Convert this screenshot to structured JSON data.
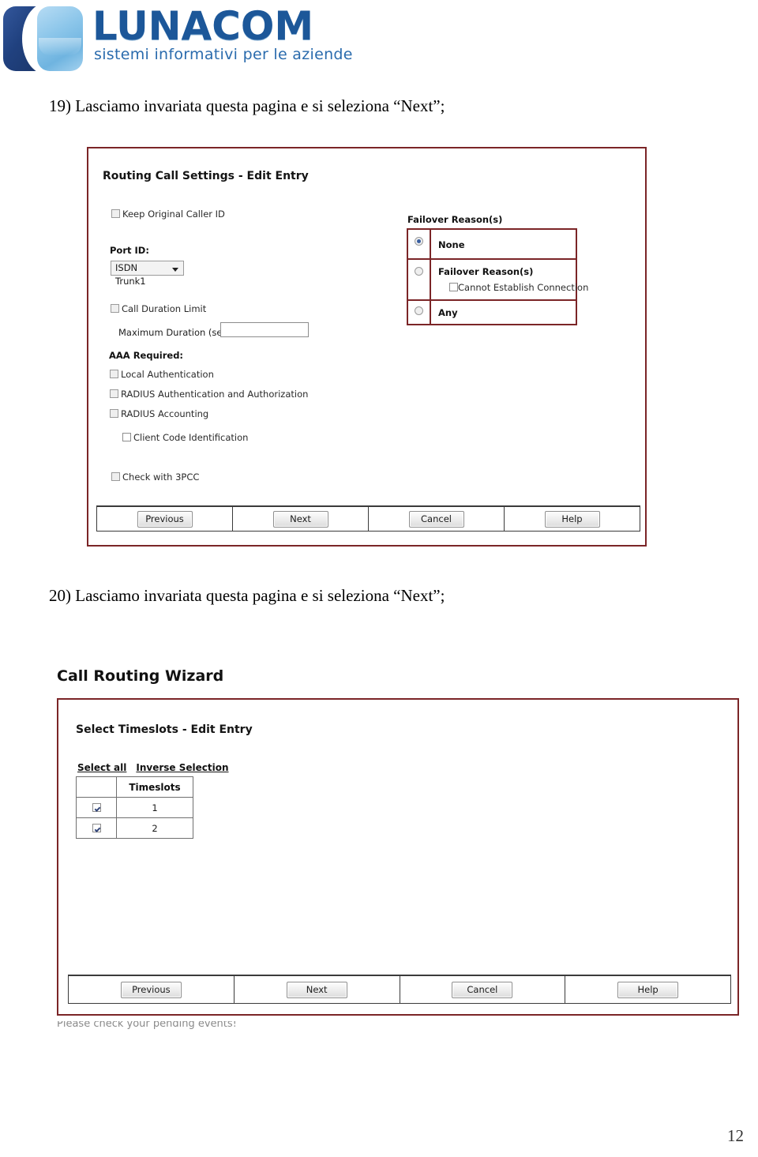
{
  "brand": {
    "name": "LUNACOM",
    "tagline": "sistemi informativi per le aziende",
    "logo_icon": "lunacom-logo-icon",
    "colors": {
      "dark_blue": "#20417f",
      "light_blue": "#8cc6ea",
      "wordmark": "#1c5799"
    }
  },
  "steps": {
    "step19": "19) Lasciamo invariata questa pagina e si seleziona “Next”;",
    "step20": "20) Lasciamo invariata questa pagina e si seleziona “Next”;"
  },
  "dialog1": {
    "title": "Routing Call Settings - Edit Entry",
    "border_color": "#7b2527",
    "keep_caller_id": {
      "label": "Keep Original Caller ID",
      "checked": false
    },
    "port_id": {
      "label": "Port ID:",
      "value": "ISDN Trunk1"
    },
    "call_duration_limit": {
      "label": "Call Duration Limit",
      "checked": false
    },
    "maximum_duration": {
      "label": "Maximum Duration (sec):",
      "value": ""
    },
    "aaa_required_label": "AAA Required:",
    "aaa_items": [
      {
        "label": "Local Authentication",
        "checked": false
      },
      {
        "label": "RADIUS Authentication and Authorization",
        "checked": false
      },
      {
        "label": "RADIUS Accounting",
        "checked": false
      }
    ],
    "client_code": {
      "label": "Client Code Identification",
      "checked": false
    },
    "check_3pcc": {
      "label": "Check with 3PCC",
      "checked": false
    },
    "failover": {
      "group_label": "Failover Reason(s)",
      "options": [
        {
          "label": "None",
          "selected": true
        },
        {
          "label": "Failover Reason(s)",
          "selected": false,
          "sub_label": "Cannot Establish Connection",
          "sub_checked": false
        },
        {
          "label": "Any",
          "selected": false
        }
      ]
    },
    "buttons": [
      "Previous",
      "Next",
      "Cancel",
      "Help"
    ]
  },
  "dialog2": {
    "wizard_title": "Call Routing Wizard",
    "title": "Select Timeslots - Edit Entry",
    "border_color": "#7b2527",
    "links": [
      "Select all",
      "Inverse Selection"
    ],
    "table": {
      "header": [
        "",
        "Timeslots"
      ],
      "rows": [
        {
          "checked": true,
          "value": "1"
        },
        {
          "checked": true,
          "value": "2"
        }
      ]
    },
    "buttons": [
      "Previous",
      "Next",
      "Cancel",
      "Help"
    ]
  },
  "footer": {
    "pending_note": "Please check your pending events!",
    "page_number": "12"
  }
}
